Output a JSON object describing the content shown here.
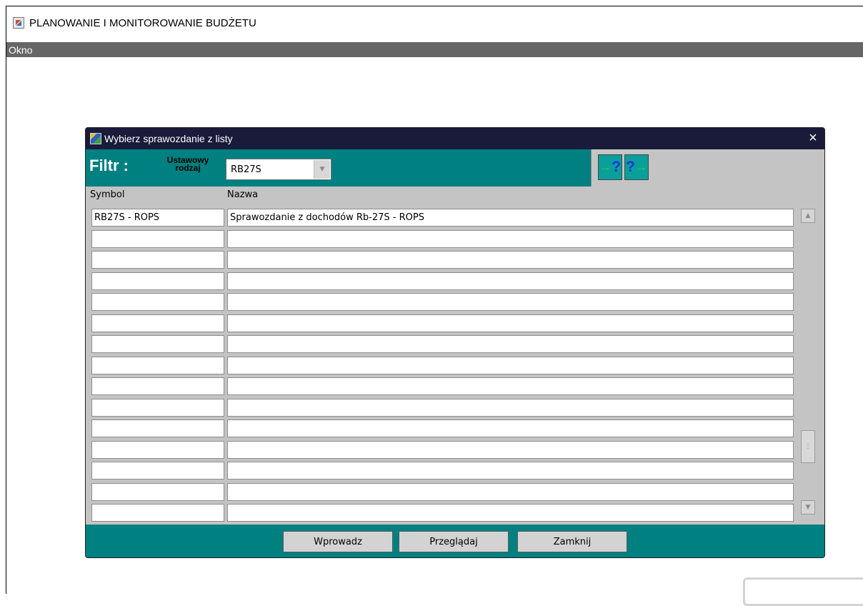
{
  "app": {
    "title": "PLANOWANIE I MONITOROWANIE BUDŻETU"
  },
  "menu": {
    "items": [
      {
        "label": "Okno"
      }
    ]
  },
  "dialog": {
    "title": "Wybierz sprawozdanie z listy",
    "close_symbol": "×",
    "filter": {
      "label": "Filtr :",
      "sublabel_line1": "Ustawowy",
      "sublabel_line2": "rodzaj",
      "select_value": "RB27S"
    },
    "tools": [
      {
        "name": "query-enter-icon",
        "symbol": "?"
      },
      {
        "name": "query-execute-icon",
        "symbol": "?"
      }
    ],
    "columns": {
      "symbol": "Symbol",
      "name": "Nazwa"
    },
    "rows": [
      {
        "symbol": "RB27S - ROPS",
        "name": "Sprawozdanie z dochodów Rb-27S - ROPS"
      },
      {
        "symbol": "",
        "name": ""
      },
      {
        "symbol": "",
        "name": ""
      },
      {
        "symbol": "",
        "name": ""
      },
      {
        "symbol": "",
        "name": ""
      },
      {
        "symbol": "",
        "name": ""
      },
      {
        "symbol": "",
        "name": ""
      },
      {
        "symbol": "",
        "name": ""
      },
      {
        "symbol": "",
        "name": ""
      },
      {
        "symbol": "",
        "name": ""
      },
      {
        "symbol": "",
        "name": ""
      },
      {
        "symbol": "",
        "name": ""
      },
      {
        "symbol": "",
        "name": ""
      },
      {
        "symbol": "",
        "name": ""
      },
      {
        "symbol": "",
        "name": ""
      }
    ],
    "buttons": {
      "enter": "Wprowadz",
      "browse": "Przeglądaj",
      "close": "Zamknij"
    }
  }
}
